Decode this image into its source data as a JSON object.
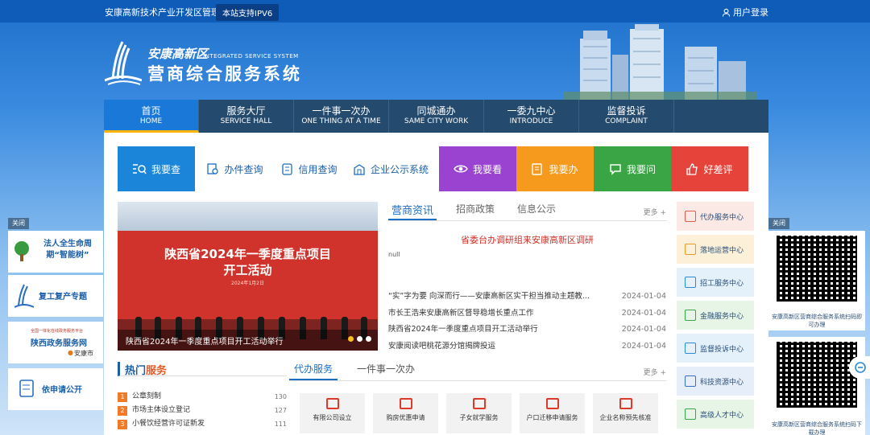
{
  "topbar": {
    "org": "安康高新技术产业开发区管理委员会",
    "ipv6": "本站支持IPV6",
    "login": "用户登录"
  },
  "header": {
    "title_small": "安康高新区",
    "title_en": "INTEGRATED SERVICE SYSTEM",
    "title_big": "营商综合服务系统"
  },
  "nav": [
    {
      "cn": "首页",
      "en": "HOME"
    },
    {
      "cn": "服务大厅",
      "en": "SERVICE HALL"
    },
    {
      "cn": "一件事一次办",
      "en": "ONE THING AT A TIME"
    },
    {
      "cn": "同城通办",
      "en": "SAME CITY WORK"
    },
    {
      "cn": "一委九中心",
      "en": "INTRODUCE"
    },
    {
      "cn": "监督投诉",
      "en": "COMPLAINT"
    }
  ],
  "quick": {
    "search": "我要查",
    "query1": "办件查询",
    "query2": "信用查询",
    "query3": "企业公示系统",
    "see": "我要看",
    "do": "我要办",
    "ask": "我要问",
    "review": "好差评"
  },
  "carousel": {
    "headline": "陕西省2024年一季度重点项目\n开工活动",
    "date": "2024年1月2日",
    "caption": "陕西省2024年一季度重点项目开工活动举行"
  },
  "news": {
    "tabs": [
      "营商资讯",
      "招商政策",
      "信息公示"
    ],
    "more": "更多 +",
    "lead": "省委台办调研组来安康高新区调研",
    "lead_sub": "null",
    "items": [
      {
        "title": "“实”字为要 向深而行——安康高新区实干担当推动主题教...",
        "date": "2024-01-04"
      },
      {
        "title": "市长王浩来安康高新区督导稳增长重点工作",
        "date": "2024-01-04"
      },
      {
        "title": "陕西省2024年一季度重点项目开工活动举行",
        "date": "2024-01-04"
      },
      {
        "title": "安康阅读吧桃花源分馆揭牌投运",
        "date": "2024-01-04"
      }
    ]
  },
  "services": [
    "代办服务中心",
    "落地运营中心",
    "招工服务中心",
    "金融服务中心",
    "监督投诉中心",
    "科技资源中心",
    "高级人才中心"
  ],
  "hot": {
    "title_a": "热门",
    "title_b": "服务",
    "items": [
      {
        "n": "1",
        "label": "公章刻制",
        "count": "130"
      },
      {
        "n": "2",
        "label": "市场主体设立登记",
        "count": "127"
      },
      {
        "n": "3",
        "label": "小餐饮经营许可证新发",
        "count": "111"
      }
    ]
  },
  "proxy": {
    "tabs": [
      "代办服务",
      "一件事一次办"
    ],
    "more": "更多 +",
    "cards": [
      "有限公司设立",
      "购房优惠申请",
      "子女就学服务",
      "户口迁移申请服务",
      "企业名称预先核准"
    ]
  },
  "left_float": {
    "close": "关闭",
    "box1": "法人全生命周期“智能树”",
    "box2": "复工复产专题",
    "box3_small": "全国一体化在线政务服务平台",
    "box3": "陕西政务服务网",
    "box3_sub": "安康市",
    "box4": "依申请公开"
  },
  "right_float": {
    "close": "关闭",
    "qr1_cap": "安康高新区营商综合服务系统扫码即可办理",
    "qr2_cap": "安康高新区营商综合服务系统扫码下载办理"
  }
}
